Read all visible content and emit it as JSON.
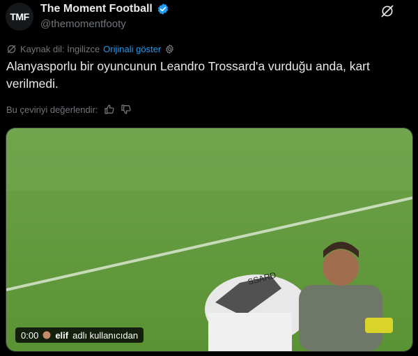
{
  "account": {
    "avatar_text": "TMF",
    "display_name": "The Moment Football",
    "handle": "@themomentfooty"
  },
  "translation": {
    "source_language": "Kaynak dil: İngilizce",
    "show_original": "Orijinali göster",
    "rate_label": "Bu çeviriyi değerlendir:"
  },
  "tweet": {
    "text": "Alanyasporlu bir oyuncunun Leandro Trossard'a vurduğu anda, kart verilmedi."
  },
  "media": {
    "timestamp": "0:00",
    "credit_user": "elif",
    "credit_suffix": "adlı kullanıcıdan",
    "shirt_text": "SSARD"
  },
  "colors": {
    "accent": "#1d9bf0",
    "secondary_text": "#71767b",
    "pitch": "#5f9a3a"
  }
}
